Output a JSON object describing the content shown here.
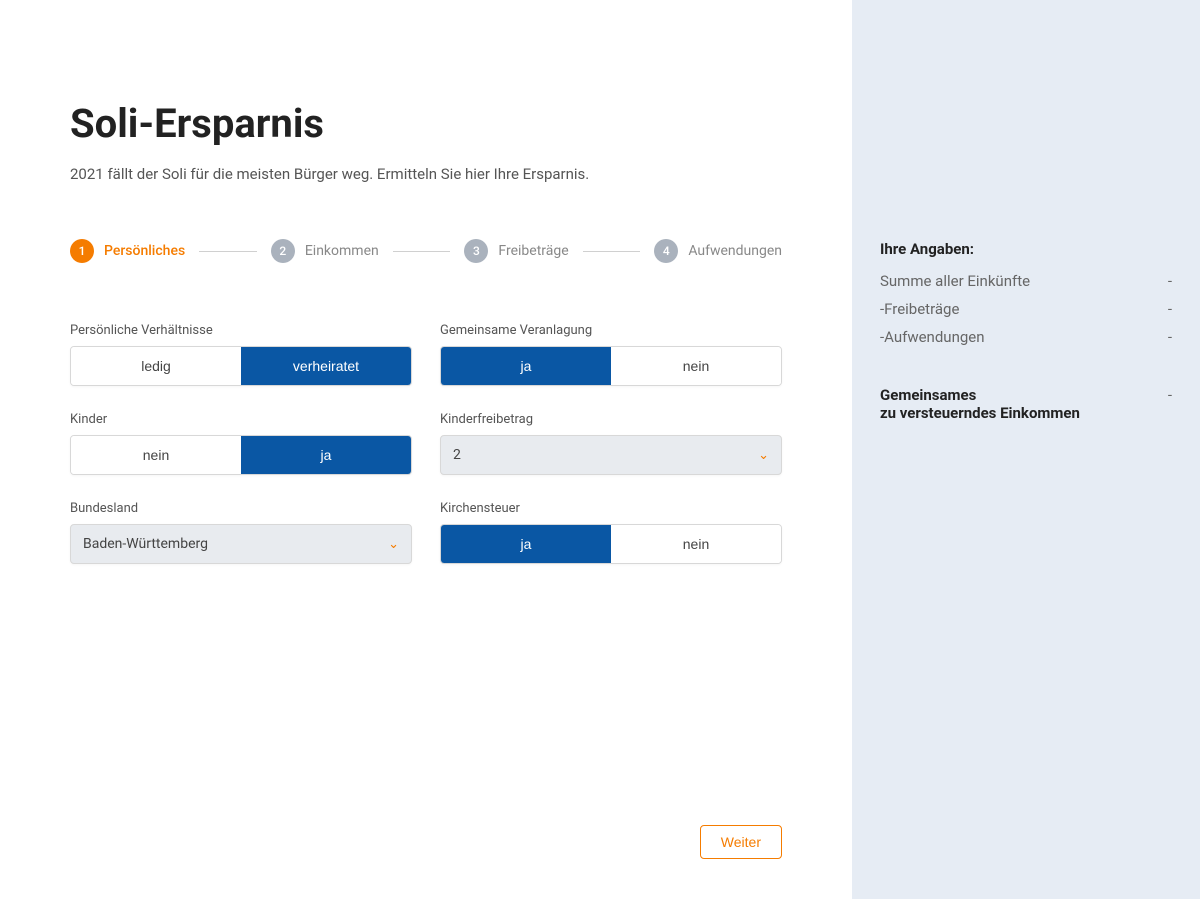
{
  "header": {
    "title": "Soli-Ersparnis",
    "subtitle": "2021 fällt der Soli für die meisten Bürger weg. Ermitteln Sie hier Ihre Ersparnis."
  },
  "stepper": [
    {
      "num": "1",
      "label": "Persönliches",
      "active": true
    },
    {
      "num": "2",
      "label": "Einkommen",
      "active": false
    },
    {
      "num": "3",
      "label": "Freibeträge",
      "active": false
    },
    {
      "num": "4",
      "label": "Aufwendungen",
      "active": false
    }
  ],
  "fields": {
    "verhaeltnisse": {
      "label": "Persönliche Verhältnisse",
      "option_a": "ledig",
      "option_b": "verheiratet",
      "selected": "b"
    },
    "veranlagung": {
      "label": "Gemeinsame Veranlagung",
      "option_a": "ja",
      "option_b": "nein",
      "selected": "a"
    },
    "kinder": {
      "label": "Kinder",
      "option_a": "nein",
      "option_b": "ja",
      "selected": "b"
    },
    "kinderfreibetrag": {
      "label": "Kinderfreibetrag",
      "value": "2"
    },
    "bundesland": {
      "label": "Bundesland",
      "value": "Baden-Württemberg"
    },
    "kirchensteuer": {
      "label": "Kirchensteuer",
      "option_a": "ja",
      "option_b": "nein",
      "selected": "a"
    }
  },
  "footer": {
    "next": "Weiter"
  },
  "sidebar": {
    "heading": "Ihre Angaben:",
    "rows": [
      {
        "label": "Summe aller Einkünfte",
        "value": "-"
      },
      {
        "label": "-Freibeträge",
        "value": "-"
      },
      {
        "label": "-Aufwendungen",
        "value": "-"
      }
    ],
    "total_label_1": "Gemeinsames",
    "total_label_2": "zu versteuerndes Einkommen",
    "total_value": "-"
  }
}
